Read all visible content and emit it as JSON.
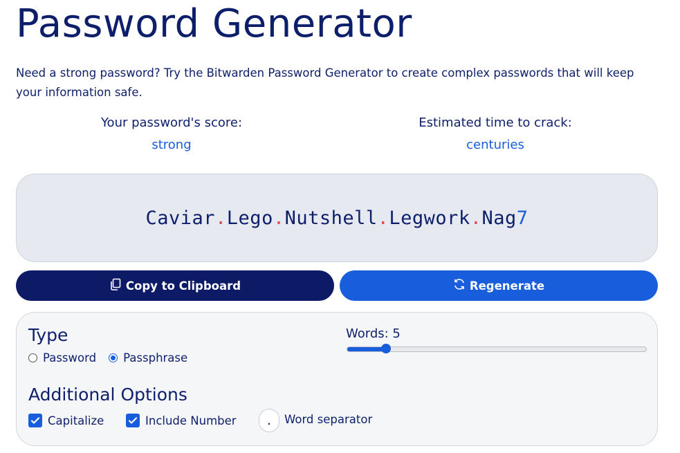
{
  "header": {
    "title": "Password Generator",
    "intro": "Need a strong password? Try the Bitwarden Password Generator to create complex passwords that will keep your information safe."
  },
  "score": {
    "label": "Your password's score:",
    "value": "strong"
  },
  "crack_time": {
    "label": "Estimated time to crack:",
    "value": "centuries"
  },
  "password": {
    "words": [
      "Caviar",
      "Lego",
      "Nutshell",
      "Legwork",
      "Nag"
    ],
    "separator": ".",
    "number": "7",
    "colors": {
      "text": "#0d1f6b",
      "separator": "#e04b5a",
      "number": "#175ddc"
    }
  },
  "actions": {
    "copy_label": "Copy to Clipboard",
    "copy_icon": "copy-icon",
    "regenerate_label": "Regenerate",
    "regenerate_icon": "refresh-icon"
  },
  "options": {
    "type_heading": "Type",
    "type_options": [
      {
        "label": "Password",
        "checked": false
      },
      {
        "label": "Passphrase",
        "checked": true
      }
    ],
    "words_label": "Words: 5",
    "words_value": 5,
    "words_fraction": 0.13,
    "additional_heading": "Additional Options",
    "capitalize": {
      "label": "Capitalize",
      "checked": true
    },
    "include_number": {
      "label": "Include Number",
      "checked": true
    },
    "word_separator": {
      "value": ".",
      "label": "Word separator"
    }
  },
  "colors": {
    "navy": "#0d1a66",
    "accent": "#175ddc",
    "panel_bg": "#e6e9ef"
  }
}
